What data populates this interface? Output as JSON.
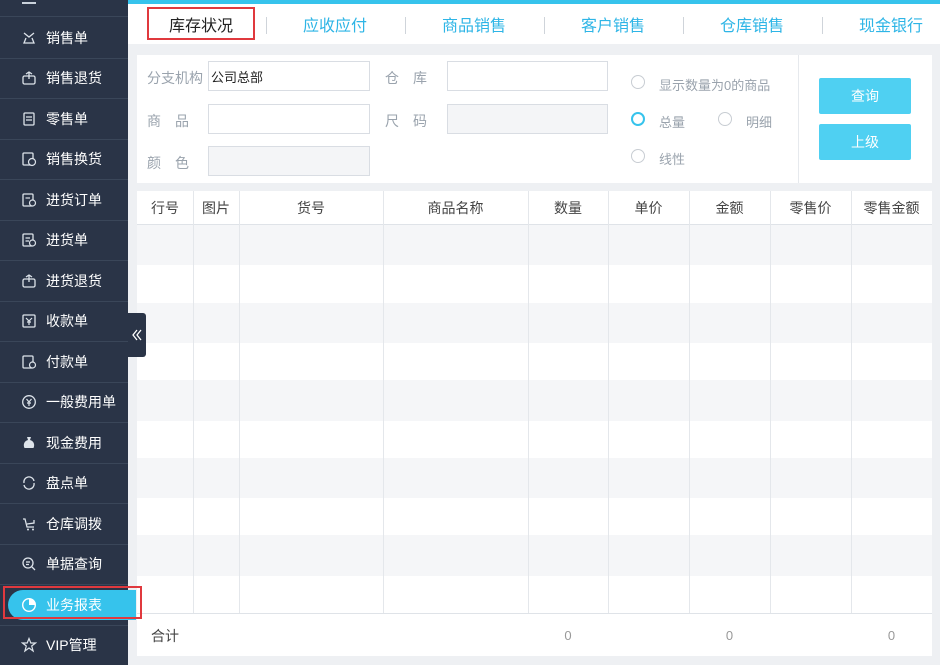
{
  "sidebar": {
    "items": [
      {
        "label": "销售单",
        "icon": "shirt-icon"
      },
      {
        "label": "销售退货",
        "icon": "return-box-icon"
      },
      {
        "label": "零售单",
        "icon": "receipt-icon"
      },
      {
        "label": "销售换货",
        "icon": "exchange-icon"
      },
      {
        "label": "进货订单",
        "icon": "order-doc-icon"
      },
      {
        "label": "进货单",
        "icon": "purchase-doc-icon"
      },
      {
        "label": "进货退货",
        "icon": "return-box-icon"
      },
      {
        "label": "收款单",
        "icon": "yen-box-icon"
      },
      {
        "label": "付款单",
        "icon": "pay-doc-icon"
      },
      {
        "label": "一般费用单",
        "icon": "yen-circle-icon"
      },
      {
        "label": "现金费用",
        "icon": "money-bag-icon"
      },
      {
        "label": "盘点单",
        "icon": "cycle-icon"
      },
      {
        "label": "仓库调拨",
        "icon": "cart-icon"
      },
      {
        "label": "单据查询",
        "icon": "search-doc-icon"
      },
      {
        "label": "业务报表",
        "icon": "pie-chart-icon"
      },
      {
        "label": "VIP管理",
        "icon": "star-icon"
      }
    ],
    "active_index": 14
  },
  "tabs": [
    "库存状况",
    "应收应付",
    "商品销售",
    "客户销售",
    "仓库销售",
    "现金银行"
  ],
  "active_tab": 0,
  "filter": {
    "branch_label": "分支机构",
    "branch_value": "公司总部",
    "warehouse_label": "仓　库",
    "warehouse_value": "",
    "product_label": "商　品",
    "product_value": "",
    "size_label": "尺　码",
    "size_value": "",
    "color_label": "颜　色",
    "color_value": "",
    "show_zero_label": "显示数量为0的商品",
    "total_label": "总量",
    "detail_label": "明细",
    "line_label": "线性",
    "query_button": "查询",
    "up_button": "上级"
  },
  "table": {
    "columns": [
      "行号",
      "图片",
      "货号",
      "商品名称",
      "数量",
      "单价",
      "金额",
      "零售价",
      "零售金额"
    ],
    "rows": [],
    "footer": [
      "合计",
      "",
      "",
      "",
      "0",
      "",
      "0",
      "",
      "0"
    ]
  },
  "colors": {
    "accent": "#36c3ec",
    "sidebar_bg": "#2a3447",
    "highlight_box": "#e0393e"
  }
}
